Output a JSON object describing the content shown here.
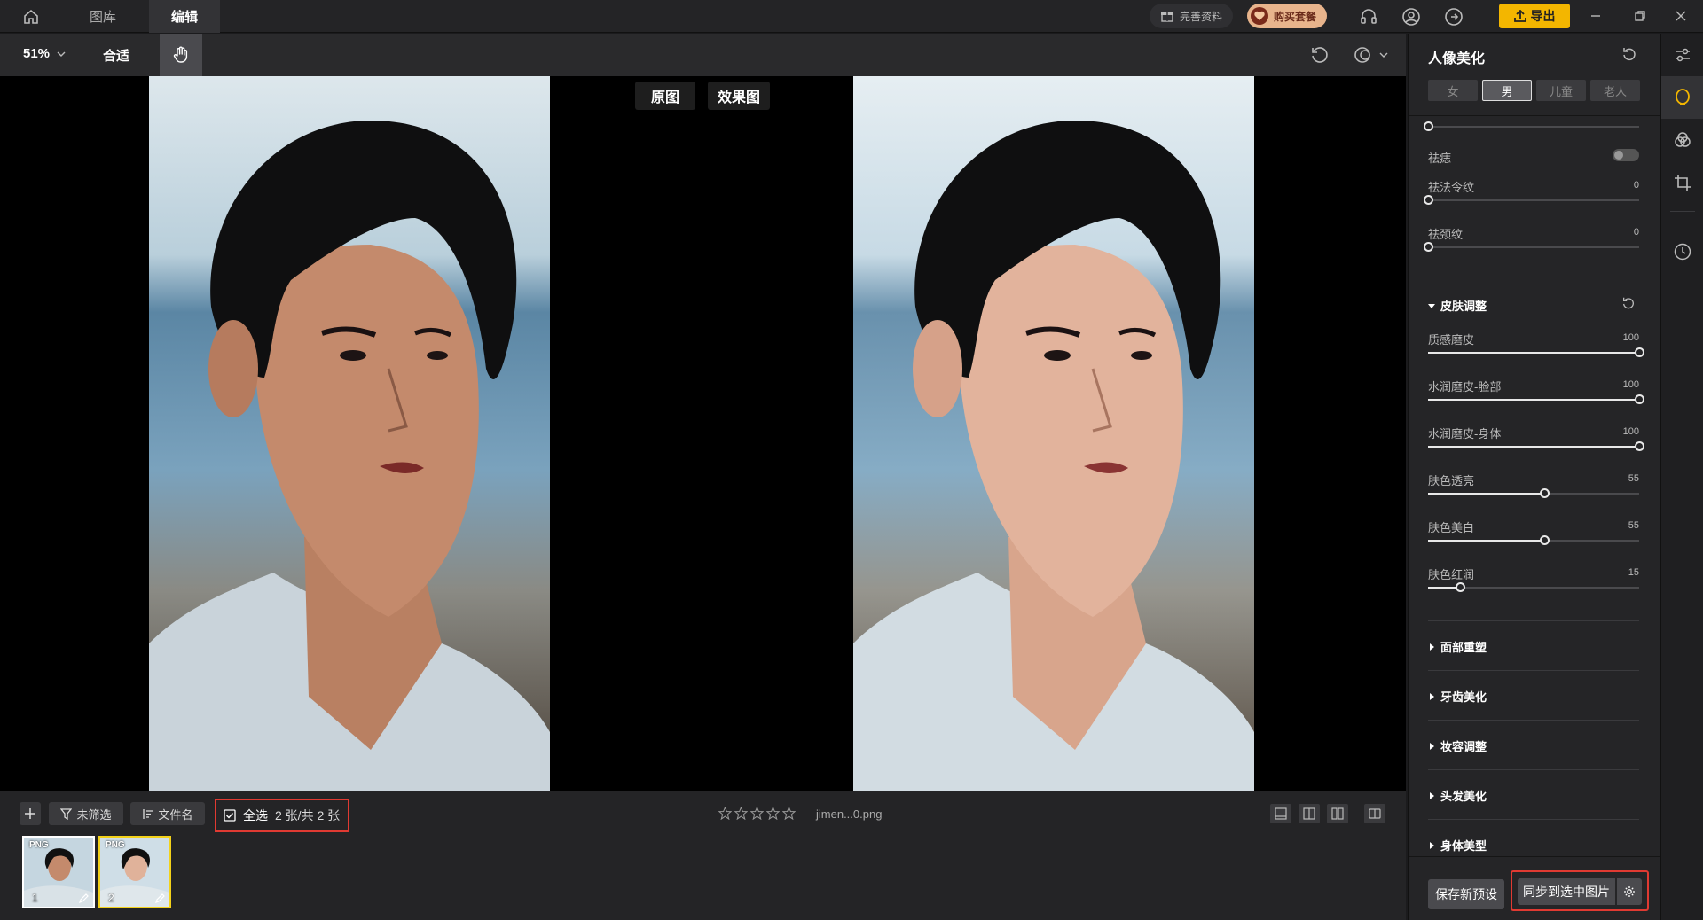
{
  "titlebar": {
    "tabs": [
      "图库",
      "编辑"
    ],
    "active_tab": "编辑",
    "profile_pill": "完善资料",
    "package_pill": "购买套餐",
    "export_label": "导出"
  },
  "toolbar": {
    "zoom_label": "51%",
    "fit_label": "合适"
  },
  "canvas": {
    "original_label": "原图",
    "effect_label": "效果图"
  },
  "bottombar": {
    "filter_label": "未筛选",
    "sort_label": "文件名",
    "select_all_label": "全选",
    "count_label": "2 张/共 2 张",
    "filename": "jimen...0.png",
    "rating": 0,
    "thumbnails": [
      {
        "badge": "PNG",
        "num": "1",
        "selected": false
      },
      {
        "badge": "PNG",
        "num": "2",
        "selected": true
      }
    ]
  },
  "panel": {
    "title": "人像美化",
    "genders": [
      "女",
      "男",
      "儿童",
      "老人"
    ],
    "active_gender": "男",
    "toggle_label": "祛痣",
    "toggle_on": false,
    "sliders_top": [
      {
        "label": "祛法令纹",
        "value": "0",
        "fraction": 0
      },
      {
        "label": "祛颈纹",
        "value": "0",
        "fraction": 0
      }
    ],
    "skin_section": "皮肤调整",
    "skin_sliders": [
      {
        "label": "质感磨皮",
        "value": "100",
        "fraction": 1.0
      },
      {
        "label": "水润磨皮-脸部",
        "value": "100",
        "fraction": 1.0
      },
      {
        "label": "水润磨皮-身体",
        "value": "100",
        "fraction": 1.0
      },
      {
        "label": "肤色透亮",
        "value": "55",
        "fraction": 0.55
      },
      {
        "label": "肤色美白",
        "value": "55",
        "fraction": 0.55
      },
      {
        "label": "肤色红润",
        "value": "15",
        "fraction": 0.15
      }
    ],
    "collapsed_sections": [
      "面部重塑",
      "牙齿美化",
      "妆容调整",
      "头发美化",
      "身体美型"
    ],
    "save_preset_label": "保存新预设",
    "sync_label": "同步到选中图片"
  },
  "colors": {
    "accent": "#f3b600",
    "highlight_box": "#e03a32",
    "thumb_selected": "#f3d21a"
  }
}
